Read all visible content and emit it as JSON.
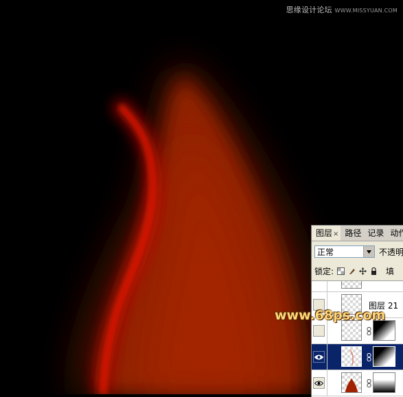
{
  "canvas": {
    "background": "#000000",
    "flame_color": "#b82600",
    "streak_color": "#e01000"
  },
  "watermarks": {
    "top_cn": "思缘设计论坛",
    "top_url": "WWW.MISSYUAN.COM",
    "mid": "www.68ps.com"
  },
  "layers_panel": {
    "tabs": [
      {
        "label": "图层",
        "close": "×",
        "active": true
      },
      {
        "label": "路径",
        "active": false
      },
      {
        "label": "记录",
        "active": false
      },
      {
        "label": "动作",
        "active": false
      }
    ],
    "blend_mode": "正常",
    "opacity_label": "不透明",
    "lock_label": "锁定:",
    "fill_label": "填",
    "layers": [
      {
        "name": "",
        "visible": false,
        "selected": false
      },
      {
        "name": "图层 21",
        "visible": false,
        "selected": false
      },
      {
        "name": "",
        "visible": false,
        "selected": false,
        "has_mask": true
      },
      {
        "name": "",
        "visible": true,
        "selected": true,
        "has_mask": true
      },
      {
        "name": "",
        "visible": true,
        "selected": false,
        "has_mask": true
      }
    ],
    "selection_color": "#0a246a"
  }
}
